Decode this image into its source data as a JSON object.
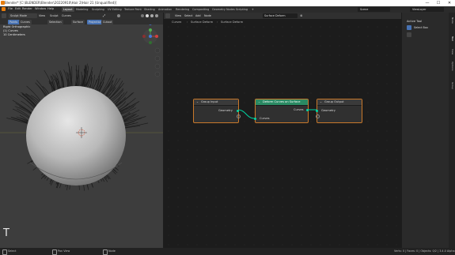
{
  "window": {
    "title": "Blender* [C:\\BLENDER\\Blender\\20220910\\Hair 2\\Hair 21 (Unqualified)]",
    "controls": [
      "—",
      "☐",
      "✕"
    ]
  },
  "menu": [
    "File",
    "Edit",
    "Render",
    "Window",
    "Help"
  ],
  "workspaces": [
    "Layout",
    "Modeling",
    "Sculpting",
    "UV Editing",
    "Texture Paint",
    "Shading",
    "Animation",
    "Rendering",
    "Compositing",
    "Geometry Nodes",
    "Scripting"
  ],
  "active_workspace": "Layout",
  "scene": {
    "name": "Scene",
    "view_layer": "ViewLayer"
  },
  "viewport": {
    "mode": "Sculpt Mode",
    "menus": [
      "View",
      "Sculpt",
      "Curves"
    ],
    "selection_modes": [
      "Points",
      "Curves"
    ],
    "tool_options": [
      "Selection",
      "Surface",
      "Projection",
      "Cutout"
    ],
    "info_line1": "Right Orthographic",
    "info_line2": "(1) Curves",
    "info_line3": "10 Centimeters",
    "tool_letter": "T"
  },
  "node_editor": {
    "menus": [
      "View",
      "Select",
      "Add",
      "Node"
    ],
    "tree_name": "Surface Deform",
    "breadcrumb": [
      "Curves",
      "Surface Deform",
      "Surface Deform"
    ],
    "nodes": {
      "group_input": {
        "title": "Group Input",
        "out_socket": "Geometry"
      },
      "deform": {
        "title": "Deform Curves on Surface",
        "in_socket": "Curves",
        "out_socket": "Curves"
      },
      "group_output": {
        "title": "Group Output",
        "in_socket": "Geometry"
      }
    }
  },
  "properties": {
    "header": "Active Tool",
    "tool_name": "Select Box"
  },
  "side_tabs": [
    "Node",
    "Tool",
    "View",
    "Options",
    "Group"
  ],
  "status": {
    "left": "Select",
    "middle": "Pan View",
    "right_action": "Node",
    "stats": "Verts: 0 | Faces: 0 | Objects: 0/2 | 3.4.0 Alpha"
  },
  "colors": {
    "accent": "#e87d0d",
    "socket_geometry": "#00d6a3",
    "node_deform_header": "#2a8a63",
    "node_border_selected": "#c9782a"
  }
}
